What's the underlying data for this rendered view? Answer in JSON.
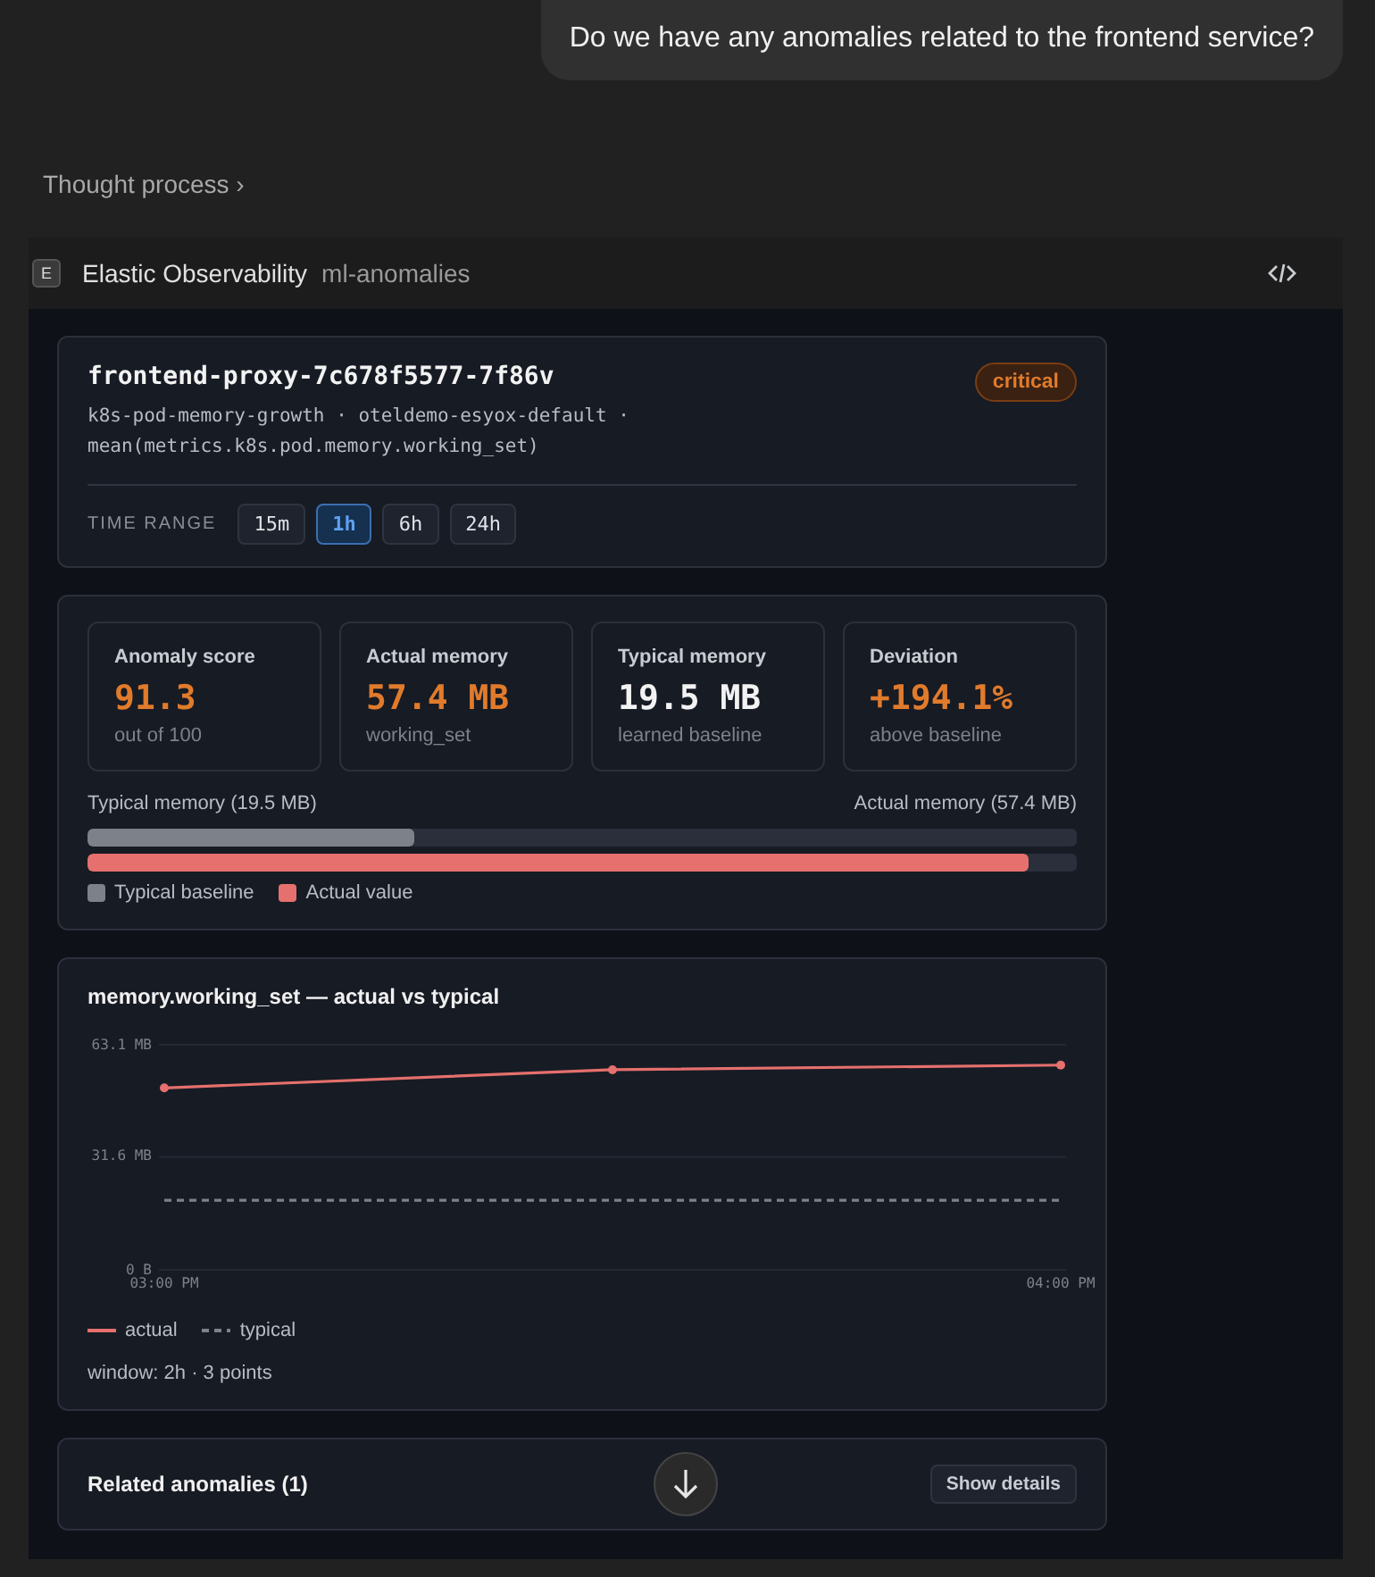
{
  "user_message": "Do we have any anomalies related to the frontend service?",
  "thought_process": {
    "label": "Thought process",
    "chevron": "›"
  },
  "tool": {
    "badge": "E",
    "name": "Elastic Observability",
    "skill": "ml-anomalies"
  },
  "anomaly": {
    "entity": "frontend-proxy-7c678f5577-7f86v",
    "severity": "critical",
    "details_line1": "k8s-pod-memory-growth · oteldemo-esyox-default ·",
    "details_line2": "mean(metrics.k8s.pod.memory.working_set)",
    "time_range_label": "TIME RANGE",
    "time_ranges": [
      {
        "label": "15m",
        "selected": false
      },
      {
        "label": "1h",
        "selected": true
      },
      {
        "label": "6h",
        "selected": false
      },
      {
        "label": "24h",
        "selected": false
      }
    ]
  },
  "stats": [
    {
      "label": "Anomaly score",
      "value": "91.3",
      "caption": "out of 100",
      "highlight": true
    },
    {
      "label": "Actual memory",
      "value": "57.4 MB",
      "caption": "working_set",
      "highlight": true
    },
    {
      "label": "Typical memory",
      "value": "19.5 MB",
      "caption": "learned baseline",
      "highlight": false
    },
    {
      "label": "Deviation",
      "value": "+194.1%",
      "caption": "above baseline",
      "highlight": true
    }
  ],
  "comparison": {
    "left_label": "Typical memory (19.5 MB)",
    "right_label": "Actual memory (57.4 MB)",
    "bars": [
      {
        "name": "Typical baseline",
        "level": 0.33,
        "color": "#7d828a"
      },
      {
        "name": "Actual value",
        "level": 0.952,
        "color": "#e5706d"
      }
    ]
  },
  "chart": {
    "title": "memory.working_set — actual vs typical",
    "footer": "window: 2h · 3 points",
    "chart_data": {
      "type": "line",
      "categories": [
        "03:00 PM",
        null,
        "04:00 PM"
      ],
      "ylim": [
        0,
        63.1
      ],
      "yticks": [
        {
          "value": 0,
          "label": "0 B"
        },
        {
          "value": 31.6,
          "label": "31.6 MB"
        },
        {
          "value": 63.1,
          "label": "63.1 MB"
        }
      ],
      "series": [
        {
          "name": "actual",
          "color": "#e5706d",
          "values": [
            51.0,
            56.1,
            57.4
          ],
          "marker": "circle"
        },
        {
          "name": "typical",
          "color": "#7d828a",
          "values": [
            19.5,
            19.5,
            19.5
          ],
          "line_style": "dashed"
        }
      ]
    }
  },
  "related": {
    "title": "Related anomalies (1)",
    "button": "Show details"
  }
}
